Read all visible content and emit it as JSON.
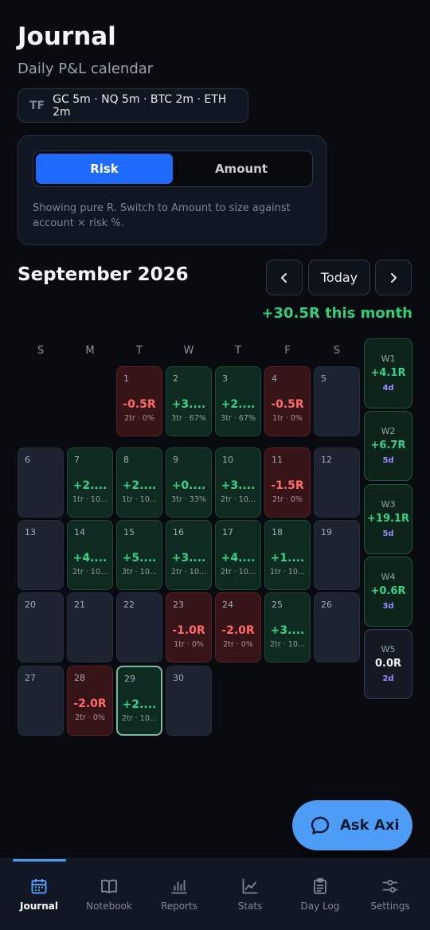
{
  "header": {
    "title": "Journal",
    "subtitle": "Daily P&L calendar"
  },
  "timeframes": {
    "label": "TF",
    "value": "GC 5m · NQ 5m · BTC 2m · ETH 2m"
  },
  "mode": {
    "options": [
      "Risk",
      "Amount"
    ],
    "selected": "Risk",
    "hint": "Showing pure R. Switch to Amount to size against account × risk %."
  },
  "calendar": {
    "month": "September 2026",
    "today_label": "Today",
    "month_total": "+30.5R this month",
    "weekdays": [
      "S",
      "M",
      "T",
      "W",
      "T",
      "F",
      "S"
    ],
    "days": [
      {
        "d": "1",
        "val": "-0.5R",
        "meta": "2tr · 0%",
        "tone": "neg"
      },
      {
        "d": "2",
        "val": "+3....",
        "meta": "3tr · 67%",
        "tone": "pos"
      },
      {
        "d": "3",
        "val": "+2....",
        "meta": "3tr · 67%",
        "tone": "pos"
      },
      {
        "d": "4",
        "val": "-0.5R",
        "meta": "1tr · 0%",
        "tone": "neg"
      },
      {
        "d": "5",
        "val": "",
        "meta": "",
        "tone": "none"
      },
      {
        "d": "6",
        "val": "",
        "meta": "",
        "tone": "none"
      },
      {
        "d": "7",
        "val": "+2....",
        "meta": "1tr · 10...",
        "tone": "pos"
      },
      {
        "d": "8",
        "val": "+2....",
        "meta": "1tr · 10...",
        "tone": "pos"
      },
      {
        "d": "9",
        "val": "+0....",
        "meta": "3tr · 33%",
        "tone": "pos"
      },
      {
        "d": "10",
        "val": "+3....",
        "meta": "2tr · 10...",
        "tone": "pos"
      },
      {
        "d": "11",
        "val": "-1.5R",
        "meta": "2tr · 0%",
        "tone": "neg"
      },
      {
        "d": "12",
        "val": "",
        "meta": "",
        "tone": "none"
      },
      {
        "d": "13",
        "val": "",
        "meta": "",
        "tone": "none"
      },
      {
        "d": "14",
        "val": "+4....",
        "meta": "2tr · 10...",
        "tone": "pos"
      },
      {
        "d": "15",
        "val": "+5....",
        "meta": "3tr · 10...",
        "tone": "pos"
      },
      {
        "d": "16",
        "val": "+3....",
        "meta": "2tr · 10...",
        "tone": "pos"
      },
      {
        "d": "17",
        "val": "+4....",
        "meta": "2tr · 10...",
        "tone": "pos"
      },
      {
        "d": "18",
        "val": "+1....",
        "meta": "1tr · 10...",
        "tone": "pos"
      },
      {
        "d": "19",
        "val": "",
        "meta": "",
        "tone": "none"
      },
      {
        "d": "20",
        "val": "",
        "meta": "",
        "tone": "none"
      },
      {
        "d": "21",
        "val": "",
        "meta": "",
        "tone": "none"
      },
      {
        "d": "22",
        "val": "",
        "meta": "",
        "tone": "none"
      },
      {
        "d": "23",
        "val": "-1.0R",
        "meta": "1tr · 0%",
        "tone": "neg"
      },
      {
        "d": "24",
        "val": "-2.0R",
        "meta": "2tr · 0%",
        "tone": "neg"
      },
      {
        "d": "25",
        "val": "+3....",
        "meta": "2tr · 10...",
        "tone": "pos"
      },
      {
        "d": "26",
        "val": "",
        "meta": "",
        "tone": "none"
      },
      {
        "d": "27",
        "val": "",
        "meta": "",
        "tone": "none"
      },
      {
        "d": "28",
        "val": "-2.0R",
        "meta": "2tr · 0%",
        "tone": "neg"
      },
      {
        "d": "29",
        "val": "+2....",
        "meta": "2tr · 10...",
        "tone": "pos",
        "today": true
      },
      {
        "d": "30",
        "val": "",
        "meta": "",
        "tone": "none"
      }
    ],
    "weeks": [
      {
        "label": "W1",
        "val": "+4.1R",
        "days": "4d"
      },
      {
        "label": "W2",
        "val": "+6.7R",
        "days": "5d"
      },
      {
        "label": "W3",
        "val": "+19.1R",
        "days": "5d"
      },
      {
        "label": "W4",
        "val": "+0.6R",
        "days": "3d"
      },
      {
        "label": "W5",
        "val": "0.0R",
        "days": "2d",
        "flat": true
      }
    ]
  },
  "assistant": {
    "label": "Ask Axi"
  },
  "tabs": [
    {
      "label": "Journal",
      "icon": "calendar-icon",
      "active": true
    },
    {
      "label": "Notebook",
      "icon": "book-icon"
    },
    {
      "label": "Reports",
      "icon": "bar-chart-icon"
    },
    {
      "label": "Stats",
      "icon": "line-chart-icon"
    },
    {
      "label": "Day Log",
      "icon": "clipboard-icon"
    },
    {
      "label": "Settings",
      "icon": "sliders-icon"
    }
  ],
  "colors": {
    "accent": "#1f6bff",
    "positive": "#35d488",
    "negative": "#ff6a6a",
    "fab": "#4d9df7"
  }
}
